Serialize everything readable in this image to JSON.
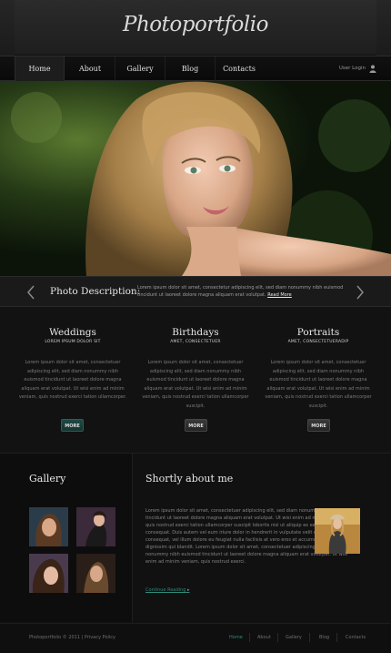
{
  "header": {
    "logo": "Photoportfolio"
  },
  "nav": {
    "items": [
      "Home",
      "About",
      "Gallery",
      "Blog",
      "Contacts"
    ],
    "user_login": "User Login"
  },
  "description": {
    "title": "Photo Description:",
    "text": "Lorem ipsum dolor sit amet, consectetur adipiscing elit, sed diam nonummy nibh euismod tincidunt ut laoreet dolore magna aliquam erat volutpat.",
    "read_more": "Read More"
  },
  "services": [
    {
      "title": "Weddings",
      "subtitle": "LOREM IPSUM DOLOR SIT",
      "text": "Lorem ipsum dolor sit amet, consectetuer adipiscing elit, sed diam nonummy nibh euismod tincidunt ut laoreet dolore magna aliquam erat volutpat. Ut wisi enim ad minim veniam, quis nostrud exerci tation ullamcorper.",
      "button": "MORE"
    },
    {
      "title": "Birthdays",
      "subtitle": "AMET, CONSECTETUER",
      "text": "Lorem ipsum dolor sit amet, consectetuer adipiscing elit, sed diam nonummy nibh euismod tincidunt ut laoreet dolore magna aliquam erat volutpat. Ut wisi enim ad minim veniam, quis nostrud exerci tation ullamcorper suscipit.",
      "button": "MORE"
    },
    {
      "title": "Portraits",
      "subtitle": "AMET, CONSECTETUERADIP",
      "text": "Lorem ipsum dolor sit amet, consectetuer adipiscing elit, sed diam nonummy nibh euismod tincidunt ut laoreet dolore magna aliquam erat volutpat. Ut wisi enim ad minim veniam, quis nostrud exerci tation ullamcorper suscipit.",
      "button": "MORE"
    }
  ],
  "gallery": {
    "title": "Gallery"
  },
  "about": {
    "title": "Shortly about me",
    "text": "Lorem ipsum dolor sit amet, consectetuer adipiscing elit, sed diam nonummy nibh euismod tincidunt ut laoreet dolore magna aliquam erat volutpat. Ut wisi enim ad minim veniam, quis nostrud exerci tation ullamcorper suscipit lobortis nisl ut aliquip ex ea commodo consequat. Duis autem vel eum iriure dolor in hendrerit in vulputate velit esse molestie consequat, vel illum dolore eu feugiat nulla facilisis at vero eros et accumsan et iusto odio dignissim qui blandit. Lorem ipsum dolor sit amet, consectetuer adipiscing elit, sed diam nonummy nibh euismod tincidunt ut laoreet dolore magna aliquam erat volutpat. Ut wisi enim ad minim veniam, quis nostrud exerci.",
    "continue": "Continue Reading"
  },
  "footer": {
    "copyright": "Photoportfolio © 2011 | Privacy Policy",
    "links": [
      "Home",
      "About",
      "Gallery",
      "Blog",
      "Contacts"
    ]
  }
}
